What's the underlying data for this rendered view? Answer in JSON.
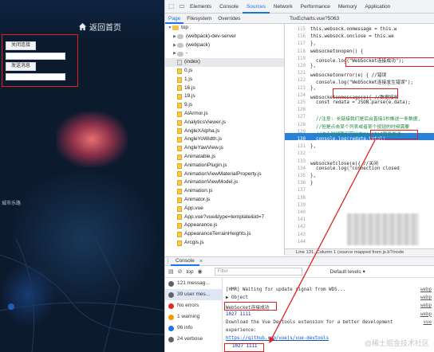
{
  "app": {
    "home_label": "返回首页",
    "btn1_label": "关闭连接",
    "btn2_label": "发送消息",
    "map_label": "城市乐路"
  },
  "devtools": {
    "tabs": [
      "Elements",
      "Console",
      "Sources",
      "Network",
      "Performance",
      "Memory",
      "Application"
    ],
    "active_tab": "Sources",
    "nav_tabs": [
      "Page",
      "Filesystem",
      "Overrides"
    ],
    "active_nav": "Page",
    "editor_tab": "TsxEcharts.vue?5063",
    "tree": [
      {
        "label": "top",
        "type": "folder",
        "depth": 0
      },
      {
        "label": "(webpack)-dev-server",
        "type": "cloud",
        "depth": 1
      },
      {
        "label": "(webpack)",
        "type": "cloud",
        "depth": 1
      },
      {
        "label": "-",
        "type": "cloud",
        "depth": 1
      },
      {
        "label": "(index)",
        "type": "grey",
        "depth": 1
      },
      {
        "label": "0.js",
        "type": "file",
        "depth": 1
      },
      {
        "label": "1.js",
        "type": "file",
        "depth": 1
      },
      {
        "label": "16.js",
        "type": "file",
        "depth": 1
      },
      {
        "label": "19.js",
        "type": "file",
        "depth": 1
      },
      {
        "label": "9.js",
        "type": "file",
        "depth": 1
      },
      {
        "label": "AlArmor.js",
        "type": "file",
        "depth": 1
      },
      {
        "label": "AnalyticsViewer.js",
        "type": "file",
        "depth": 1
      },
      {
        "label": "AngleXAlpha.js",
        "type": "file",
        "depth": 1
      },
      {
        "label": "AngleYoWidth.js",
        "type": "file",
        "depth": 1
      },
      {
        "label": "AngleYawView.js",
        "type": "file",
        "depth": 1
      },
      {
        "label": "Animatable.js",
        "type": "file",
        "depth": 1
      },
      {
        "label": "AnimationPlugin.js",
        "type": "file",
        "depth": 1
      },
      {
        "label": "AnimationViewMaterialProperty.js",
        "type": "file",
        "depth": 1
      },
      {
        "label": "AnimationViewModel.js",
        "type": "file",
        "depth": 1
      },
      {
        "label": "Animation.js",
        "type": "file",
        "depth": 1
      },
      {
        "label": "Animator.js",
        "type": "file",
        "depth": 1
      },
      {
        "label": "App.vue",
        "type": "file",
        "depth": 1
      },
      {
        "label": "App.vue?vue&type=template&id=7",
        "type": "file",
        "depth": 1
      },
      {
        "label": "Appearance.js",
        "type": "file",
        "depth": 1
      },
      {
        "label": "AppearanceTerrainHeights.js",
        "type": "file",
        "depth": 1
      },
      {
        "label": "Arcgis.js",
        "type": "file",
        "depth": 1
      }
    ],
    "code_lines": [
      {
        "n": "115",
        "text": "this.websock.onmessage = this.w"
      },
      {
        "n": "116",
        "text": "this.websock.onclose = this.we"
      },
      {
        "n": "117",
        "text": "},"
      },
      {
        "n": "118",
        "text": "websocketonopen() {"
      },
      {
        "n": "119",
        "text": "  console.log(\"WebSocket连接成功\");"
      },
      {
        "n": "120",
        "text": "},"
      },
      {
        "n": "121",
        "text": "websocketonerror(e) { //错误"
      },
      {
        "n": "122",
        "text": "  console.log(\"WebSocket连接发生错误\");"
      },
      {
        "n": "123",
        "text": "},"
      },
      {
        "n": "124",
        "text": "websocketonmessage(e){ //数据接收"
      },
      {
        "n": "125",
        "text": "  const redata = JSON.parse(e.data);"
      },
      {
        "n": "126",
        "text": ""
      },
      {
        "n": "127",
        "text": "  //注意: 长链接我们是后台直接1秒推送一条数据,"
      },
      {
        "n": "128",
        "text": "  //但是点击某个列表或者某个按钮的时候需要"
      },
      {
        "n": "129",
        "text": "  //这个时候我们可以在mounted里面发送"
      },
      {
        "n": "130",
        "text": "  console.log(redata.total)"
      },
      {
        "n": "131",
        "text": "},"
      },
      {
        "n": "132",
        "text": ""
      },
      {
        "n": "133",
        "text": "websocketclose(e){ //关闭"
      },
      {
        "n": "134",
        "text": "  console.log(\"connection closed"
      },
      {
        "n": "135",
        "text": "},"
      },
      {
        "n": "136",
        "text": "}"
      },
      {
        "n": "137",
        "text": ""
      },
      {
        "n": "138",
        "text": ""
      },
      {
        "n": "139",
        "text": ""
      },
      {
        "n": "140",
        "text": ""
      },
      {
        "n": "141",
        "text": ""
      },
      {
        "n": "142",
        "text": ""
      },
      {
        "n": "143",
        "text": ""
      },
      {
        "n": "144",
        "text": ""
      }
    ],
    "status_text": "Line 131, Column 1  (source mapped from js.b?/node",
    "console_tab": "Console",
    "context": "top",
    "filter_placeholder": "Filter",
    "levels": "Default levels ▾",
    "sidebar": [
      {
        "label": "121 messag...",
        "color": "#5f6368"
      },
      {
        "label": "39 user mes...",
        "color": "#5f6368"
      },
      {
        "label": "No errors",
        "color": "#d93025"
      },
      {
        "label": "1 warning",
        "color": "#f29900"
      },
      {
        "label": "96 info",
        "color": "#1a73e8"
      },
      {
        "label": "24 verbose",
        "color": "#5f6368"
      }
    ],
    "log": [
      {
        "text": "[HMR] Waiting for update signal from WDS...",
        "src": "webp"
      },
      {
        "text": "▶ Object",
        "src": "webp"
      },
      {
        "text": "WebSocket连接成功",
        "src": "webp"
      },
      {
        "text": "1027 1111",
        "src": "webp"
      },
      {
        "text": "Download the Vue Devtools extension for a better development",
        "src": "vue"
      },
      {
        "text": "experience:",
        "src": ""
      },
      {
        "text": "https://github.com/vuejs/vue-devtools",
        "src": ""
      },
      {
        "text": "1027 1111",
        "src": ""
      }
    ],
    "watermark": "@稀土掘金技术社区"
  }
}
